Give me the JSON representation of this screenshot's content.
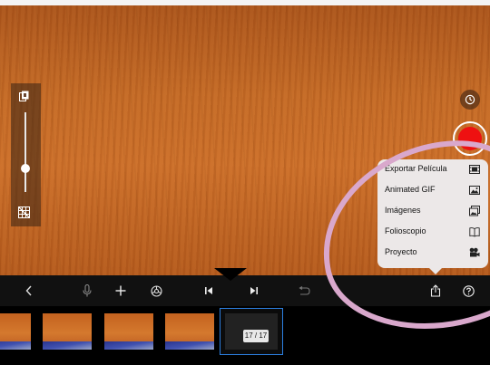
{
  "camera": {
    "left_panel": {
      "onion_icon": "onion-skin-icon",
      "slider_level": 0.7,
      "grid_icon": "grid-icon"
    },
    "timer_icon": "timer-icon",
    "record_color": "#ee1111"
  },
  "toolbar": {
    "icons": [
      "back-chevron-icon",
      "microphone-icon",
      "add-icon",
      "settings-icon",
      "skip-start-icon",
      "skip-end-icon",
      "undo-icon",
      "share-icon",
      "help-icon"
    ],
    "back_label": "<",
    "add_label": "+"
  },
  "share_menu": {
    "items": [
      {
        "label": "Exportar Película",
        "icon": "film-icon"
      },
      {
        "label": "Animated GIF",
        "icon": "image-icon"
      },
      {
        "label": "Imágenes",
        "icon": "images-icon"
      },
      {
        "label": "Folioscopio",
        "icon": "book-icon"
      },
      {
        "label": "Proyecto",
        "icon": "film-camera-icon"
      }
    ]
  },
  "filmstrip": {
    "frame_counter": "17 / 17",
    "accent": "#2c7fe0"
  },
  "annotation": {
    "color": "#d9a8cc"
  }
}
